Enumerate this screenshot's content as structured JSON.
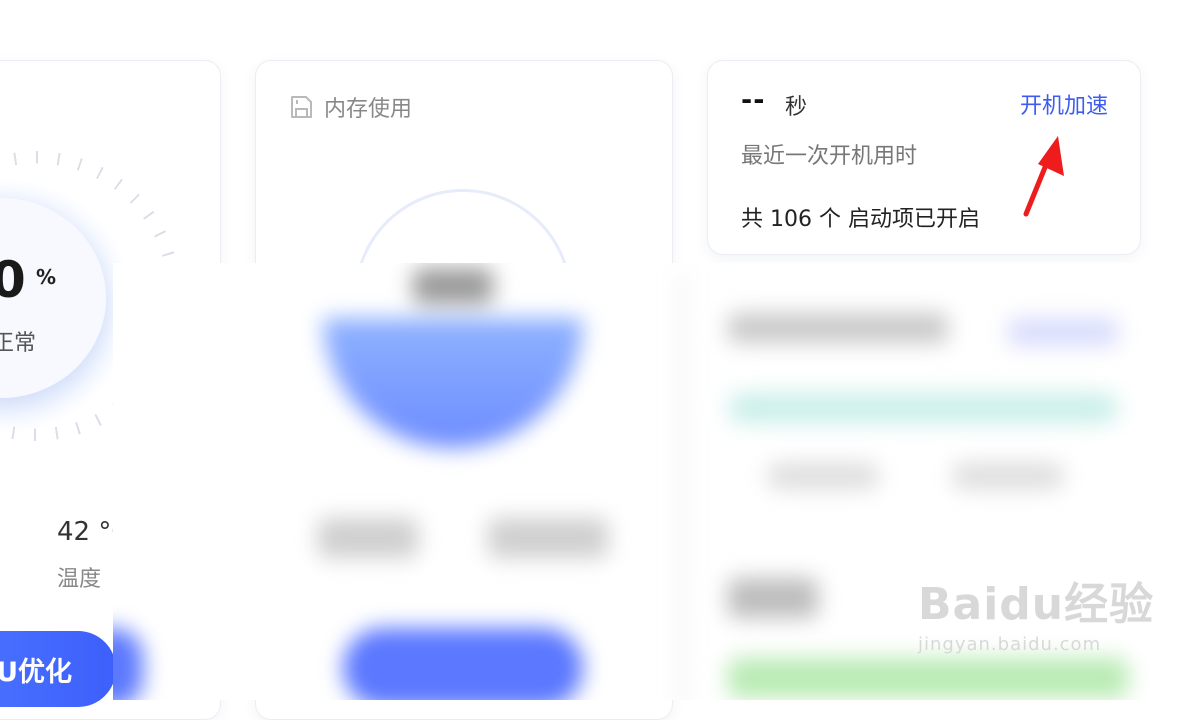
{
  "cpu_card": {
    "value": "0",
    "unit": "%",
    "status": "正常",
    "temperature_value": "42 °C",
    "temperature_label": "温度",
    "button_label": "U优化"
  },
  "memory_card": {
    "title": "内存使用",
    "icon": "save-disk-icon"
  },
  "boot_card": {
    "time_value": "--",
    "time_unit": "秒",
    "description": "最近一次开机用时",
    "startup_items": "共 106 个 启动项已开启",
    "link_label": "开机加速"
  },
  "annotation": {
    "arrow_color": "#ee1c1c"
  },
  "watermark": {
    "logo": "Baidu经验",
    "url": "jingyan.baidu.com"
  },
  "colors": {
    "accent_blue": "#3f5cf0",
    "button_gradient_start": "#4f7bff",
    "button_gradient_end": "#3d5ffc"
  }
}
